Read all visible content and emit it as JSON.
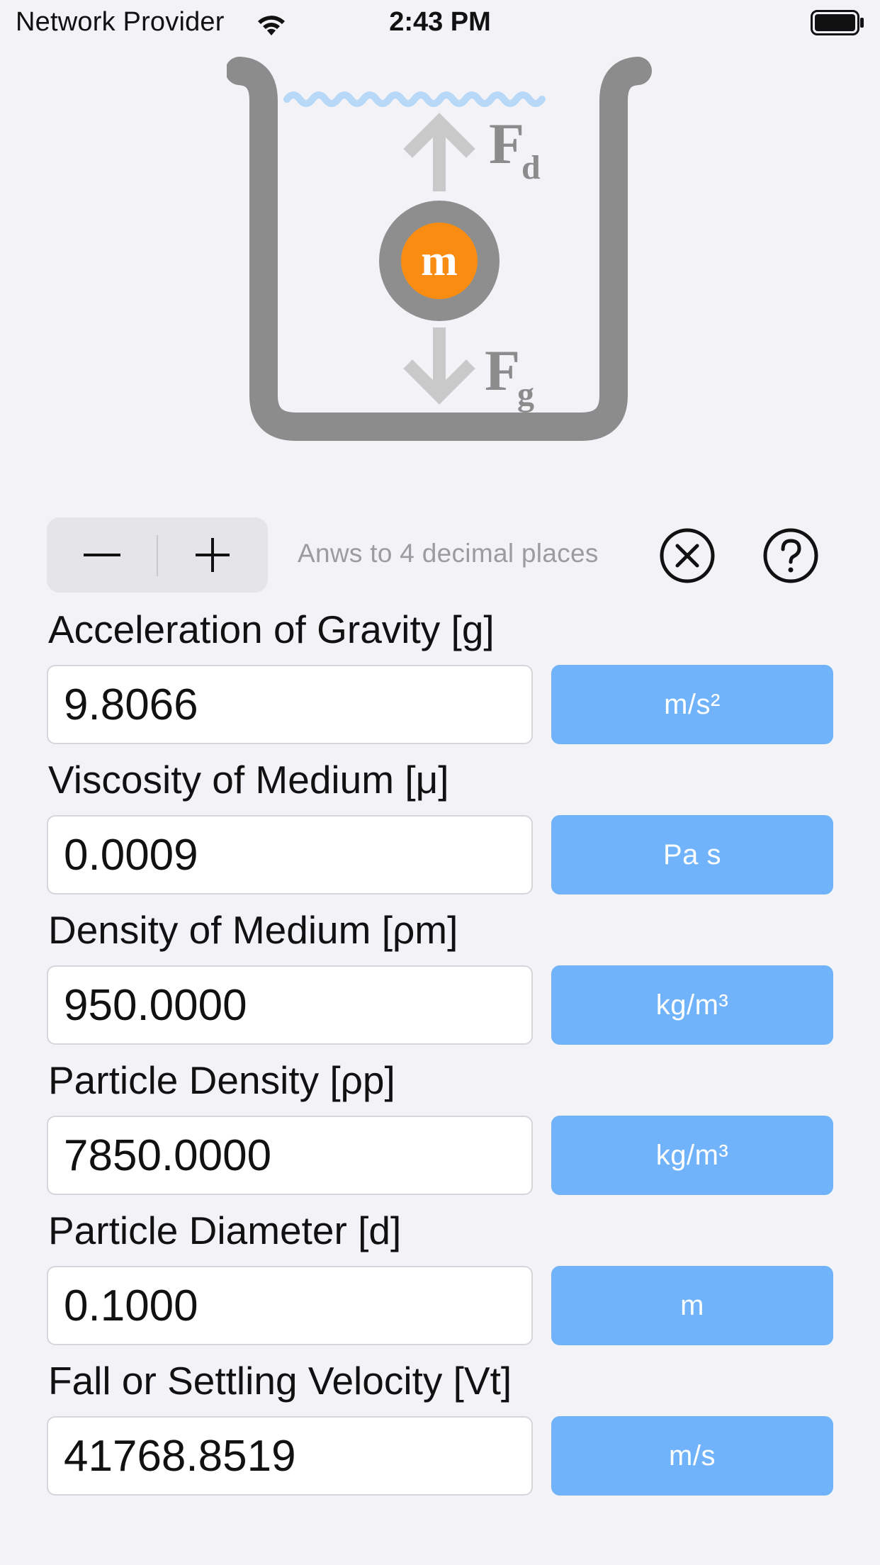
{
  "status_bar": {
    "carrier": "Network Provider",
    "time": "2:43 PM"
  },
  "diagram": {
    "mass_label": "m",
    "drag_force_symbol": "F",
    "drag_force_subscript": "d",
    "gravity_force_symbol": "F",
    "gravity_force_subscript": "g",
    "colors": {
      "container": "#8c8c8c",
      "water": "#b8d8f7",
      "arrow": "#c9c9c9",
      "mass_ring": "#8e8e8e",
      "mass_core": "#fb8c12"
    }
  },
  "toolbar": {
    "decrease_label": "−",
    "increase_label": "+",
    "precision_text": "Anws to 4 decimal places",
    "clear_icon": "circle-x-icon",
    "help_icon": "question-circle-icon"
  },
  "fields": [
    {
      "label": "Acceleration of Gravity [g]",
      "value": "9.8066",
      "unit": "m/s²"
    },
    {
      "label": "Viscosity of Medium [μ]",
      "value": "0.0009",
      "unit": "Pa s"
    },
    {
      "label": "Density of Medium [ρm]",
      "value": "950.0000",
      "unit": "kg/m³"
    },
    {
      "label": "Particle Density [ρp]",
      "value": "7850.0000",
      "unit": "kg/m³"
    },
    {
      "label": "Particle Diameter [d]",
      "value": "0.1000",
      "unit": "m"
    },
    {
      "label": "Fall or Settling Velocity [Vt]",
      "value": "41768.8519",
      "unit": "m/s"
    }
  ],
  "colors": {
    "unit_button": "#70b3fa",
    "background": "#f2f2f7"
  }
}
